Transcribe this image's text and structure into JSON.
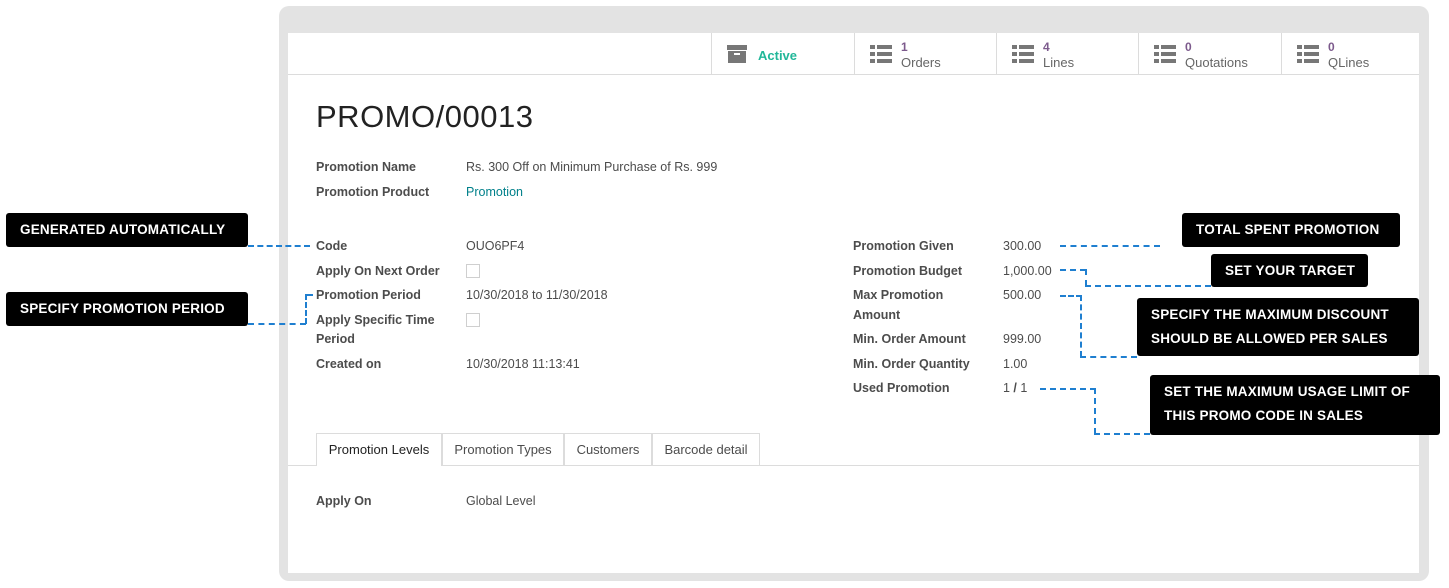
{
  "smart_buttons": {
    "active": {
      "label": "Active"
    },
    "orders": {
      "count": "1",
      "label": "Orders"
    },
    "lines": {
      "count": "4",
      "label": "Lines"
    },
    "quotations": {
      "count": "0",
      "label": "Quotations"
    },
    "qlines": {
      "count": "0",
      "label": "QLines"
    }
  },
  "record_title": "PROMO/00013",
  "fields": {
    "promotion_name": {
      "label": "Promotion Name",
      "value": "Rs. 300 Off on Minimum Purchase of Rs. 999"
    },
    "promotion_product": {
      "label": "Promotion Product",
      "value": "Promotion"
    },
    "code": {
      "label": "Code",
      "value": "OUO6PF4"
    },
    "apply_next_order": {
      "label": "Apply On Next Order",
      "checked": false
    },
    "promotion_period": {
      "label": "Promotion Period",
      "value": "10/30/2018 to 11/30/2018"
    },
    "apply_specific_time_1": "Apply Specific Time",
    "apply_specific_time_2": "Period",
    "created_on": {
      "label": "Created on",
      "value": "10/30/2018 11:13:41"
    },
    "promotion_given": {
      "label": "Promotion Given",
      "value": "300.00"
    },
    "promotion_budget": {
      "label": "Promotion Budget",
      "value": "1,000.00"
    },
    "max_promotion_1": "Max Promotion",
    "max_promotion_2": "Amount",
    "max_promotion_value": "500.00",
    "min_order_amount": {
      "label": "Min. Order Amount",
      "value": "999.00"
    },
    "min_order_qty": {
      "label": "Min. Order Quantity",
      "value": "1.00"
    },
    "used_promotion": {
      "label": "Used Promotion",
      "used": "1",
      "sep": " / ",
      "total": "1"
    }
  },
  "tabs": [
    "Promotion Levels",
    "Promotion Types",
    "Customers",
    "Barcode detail"
  ],
  "tab_content": {
    "label": "Apply On",
    "value": "Global Level"
  },
  "callouts": {
    "generated": "GENERATED AUTOMATICALLY",
    "period": "SPECIFY PROMOTION PERIOD",
    "total_spent": "TOTAL SPENT PROMOTION",
    "target": "SET YOUR TARGET",
    "max_discount_1": "SPECIFY THE MAXIMUM DISCOUNT",
    "max_discount_2": "SHOULD BE ALLOWED PER SALES",
    "usage_1": "SET THE MAXIMUM USAGE LIMIT OF",
    "usage_2": "THIS PROMO CODE IN SALES"
  },
  "colors": {
    "accent_link": "#00808a",
    "active_green": "#21b799",
    "count_purple": "#7c5a8c",
    "callout_bg": "#000000",
    "leader_line": "#1f7fd0"
  },
  "icons": {
    "active": "archive-icon",
    "stat": "list-icon"
  }
}
